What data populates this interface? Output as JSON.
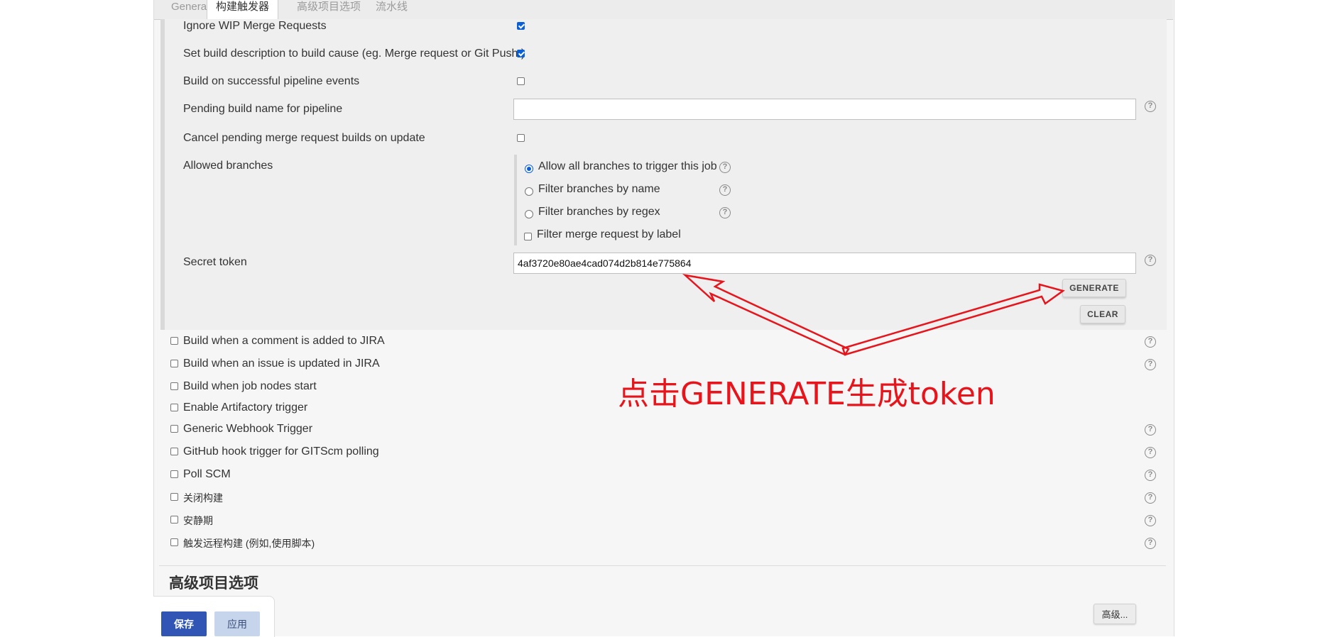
{
  "tabs": [
    {
      "label": "General"
    },
    {
      "label": "构建触发器"
    },
    {
      "label": "高级项目选项"
    },
    {
      "label": "流水线"
    }
  ],
  "gitlab": {
    "ignore_wip": {
      "label": "Ignore WIP Merge Requests",
      "checked": true
    },
    "set_description": {
      "label": "Set build description to build cause (eg. Merge request or Git Push )",
      "checked": true
    },
    "successful_pipeline": {
      "label": "Build on successful pipeline events",
      "checked": false
    },
    "pending_build_name": {
      "label": "Pending build name for pipeline",
      "value": ""
    },
    "cancel_pending": {
      "label": "Cancel pending merge request builds on update",
      "checked": false
    },
    "allowed_branches": {
      "label": "Allowed branches",
      "options": [
        {
          "label": "Allow all branches to trigger this job",
          "selected": true
        },
        {
          "label": "Filter branches by name",
          "selected": false
        },
        {
          "label": "Filter branches by regex",
          "selected": false
        }
      ],
      "filter_label": {
        "label": "Filter merge request by label",
        "checked": false
      }
    },
    "secret_token": {
      "label": "Secret token",
      "value": "4af3720e80ae4cad074d2b814e775864"
    },
    "generate_label": "GENERATE",
    "clear_label": "CLEAR"
  },
  "triggers": [
    {
      "label": "Build when a comment is added to JIRA",
      "help": true
    },
    {
      "label": "Build when an issue is updated in JIRA",
      "help": true
    },
    {
      "label": "Build when job nodes start",
      "help": false
    },
    {
      "label": "Enable Artifactory trigger",
      "help": false
    },
    {
      "label": "Generic Webhook Trigger",
      "help": true
    },
    {
      "label": "GitHub hook trigger for GITScm polling",
      "help": true
    },
    {
      "label": "Poll SCM",
      "help": true
    },
    {
      "label": "关闭构建",
      "help": true
    },
    {
      "label": "安静期",
      "help": true
    },
    {
      "label": "触发远程构建 (例如,使用脚本)",
      "help": true
    }
  ],
  "annotation": "点击GENERATE生成token",
  "section_heading": "高级项目选项",
  "footer": {
    "save_label": "保存",
    "apply_label": "应用",
    "advanced_label": "高级..."
  },
  "help_glyph": "?",
  "colors": {
    "accent_blue": "#3155b5",
    "annotation_red": "#e8141b",
    "checkbox_blue": "#0b5fd6"
  }
}
